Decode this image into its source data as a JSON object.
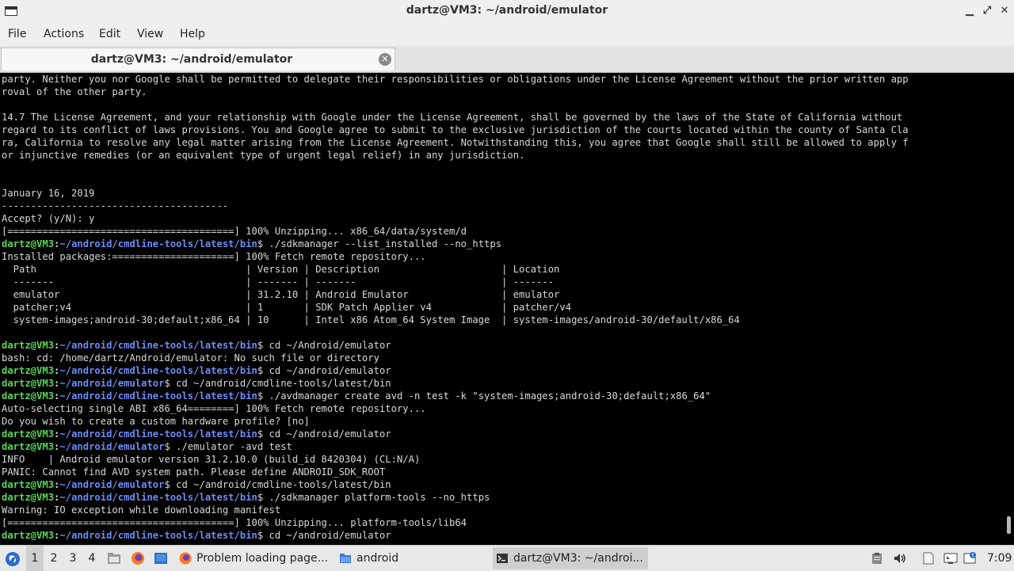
{
  "window": {
    "title": "dartz@VM3: ~/android/emulator",
    "minimize_glyph": "▁",
    "maximize_glyph": "⤢",
    "close_glyph": "✕"
  },
  "menu": [
    "File",
    "Actions",
    "Edit",
    "View",
    "Help"
  ],
  "tab": {
    "label": "dartz@VM3: ~/android/emulator",
    "close_glyph": "✕"
  },
  "prompt": {
    "user": "dartz@VM3",
    "separator": ":"
  },
  "terminal_lines": [
    {
      "text": "party. Neither you nor Google shall be permitted to delegate their responsibilities or obligations under the License Agreement without the prior written app"
    },
    {
      "text": "roval of the other party."
    },
    {
      "text": ""
    },
    {
      "text": "14.7 The License Agreement, and your relationship with Google under the License Agreement, shall be governed by the laws of the State of California without"
    },
    {
      "text": "regard to its conflict of laws provisions. You and Google agree to submit to the exclusive jurisdiction of the courts located within the county of Santa Cla"
    },
    {
      "text": "ra, California to resolve any legal matter arising from the License Agreement. Notwithstanding this, you agree that Google shall still be allowed to apply f"
    },
    {
      "text": "or injunctive remedies (or an equivalent type of urgent legal relief) in any jurisdiction."
    },
    {
      "text": ""
    },
    {
      "text": ""
    },
    {
      "text": "January 16, 2019"
    },
    {
      "text": "---------------------------------------"
    },
    {
      "text": "Accept? (y/N): y"
    },
    {
      "text": "[=======================================] 100% Unzipping... x86_64/data/system/d"
    },
    {
      "path": "~/android/cmdline-tools/latest/bin",
      "text": "$ ./sdkmanager --list_installed --no_https"
    },
    {
      "text": "Installed packages:=====================] 100% Fetch remote repository..."
    },
    {
      "text": "  Path                                    | Version | Description                     | Location"
    },
    {
      "text": "  -------                                 | ------- | -------                         | -------"
    },
    {
      "text": "  emulator                                | 31.2.10 | Android Emulator                | emulator"
    },
    {
      "text": "  patcher;v4                              | 1       | SDK Patch Applier v4            | patcher/v4"
    },
    {
      "text": "  system-images;android-30;default;x86_64 | 10      | Intel x86 Atom_64 System Image  | system-images/android-30/default/x86_64"
    },
    {
      "text": ""
    },
    {
      "path": "~/android/cmdline-tools/latest/bin",
      "text": "$ cd ~/Android/emulator"
    },
    {
      "text": "bash: cd: /home/dartz/Android/emulator: No such file or directory"
    },
    {
      "path": "~/android/cmdline-tools/latest/bin",
      "text": "$ cd ~/android/emulator"
    },
    {
      "path": "~/android/emulator",
      "text": "$ cd ~/android/cmdline-tools/latest/bin"
    },
    {
      "path": "~/android/cmdline-tools/latest/bin",
      "text": "$ ./avdmanager create avd -n test -k \"system-images;android-30;default;x86_64\""
    },
    {
      "text": "Auto-selecting single ABI x86_64========] 100% Fetch remote repository..."
    },
    {
      "text": "Do you wish to create a custom hardware profile? [no]"
    },
    {
      "path": "~/android/cmdline-tools/latest/bin",
      "text": "$ cd ~/android/emulator"
    },
    {
      "path": "~/android/emulator",
      "text": "$ ./emulator -avd test"
    },
    {
      "text": "INFO    | Android emulator version 31.2.10.0 (build_id 8420304) (CL:N/A)"
    },
    {
      "text": "PANIC: Cannot find AVD system path. Please define ANDROID_SDK_ROOT"
    },
    {
      "path": "~/android/emulator",
      "text": "$ cd ~/android/cmdline-tools/latest/bin"
    },
    {
      "path": "~/android/cmdline-tools/latest/bin",
      "text": "$ ./sdkmanager platform-tools --no_https"
    },
    {
      "text": "Warning: IO exception while downloading manifest"
    },
    {
      "text": "[=======================================] 100% Unzipping... platform-tools/lib64"
    },
    {
      "path": "~/android/cmdline-tools/latest/bin",
      "text": "$ cd ~/android/emulator"
    }
  ],
  "taskbar": {
    "workspaces": [
      "1",
      "2",
      "3",
      "4"
    ],
    "active_workspace": "1",
    "tasks": [
      {
        "label": "Problem loading page...",
        "icon": "firefox-icon"
      },
      {
        "label": "android",
        "icon": "folder-icon"
      },
      {
        "label": "dartz@VM3: ~/androi...",
        "icon": "terminal-icon"
      }
    ],
    "clock": "7:09"
  },
  "colors": {
    "prompt_user": "#57d657",
    "prompt_path": "#6d8cf5",
    "terminal_bg": "#000000",
    "terminal_fg": "#d8d8d8"
  }
}
